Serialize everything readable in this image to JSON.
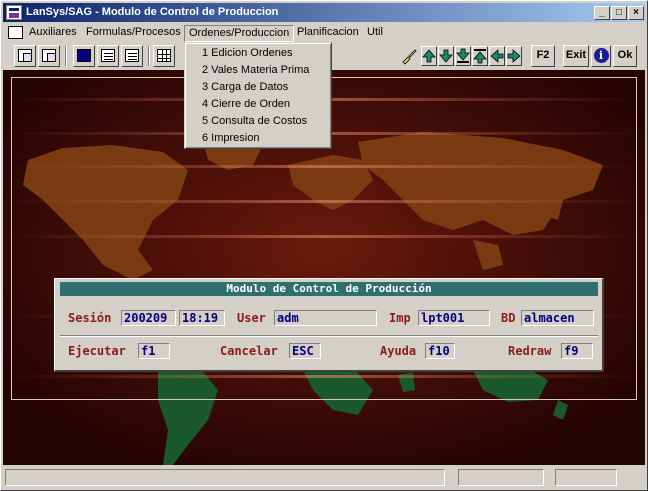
{
  "window": {
    "title": "LanSys/SAG - Modulo de Control de Produccion",
    "minimize": "_",
    "maximize": "□",
    "close": "×"
  },
  "menubar": {
    "items": [
      "Auxiliares",
      "Formulas/Procesos",
      "Ordenes/Produccion",
      "Planificacion",
      "Util"
    ],
    "active": "Ordenes/Produccion"
  },
  "dropdown": {
    "items": [
      "1 Edicion Ordenes",
      "2 Vales Materia Prima",
      "3 Carga de Datos",
      "4 Cierre de Orden",
      "5 Consulta de Costos",
      "6 Impresion"
    ]
  },
  "toolbar": {
    "f2": "F2",
    "exit": "Exit",
    "info": "i",
    "ok": "Ok",
    "icons": [
      "copy-icon",
      "paste-icon",
      "monitor-icon",
      "form-icon",
      "grid-icon",
      "table-icon",
      "brush-icon",
      "arrow-up-icon",
      "arrow-down-icon",
      "arrow-down-end-icon",
      "arrow-up-end-icon",
      "arrow-left-icon",
      "arrow-right-icon"
    ]
  },
  "dialog": {
    "title": "Modulo de Control de Producción",
    "session_label": "Sesión",
    "session_value": "200209",
    "time_value": "18:19",
    "user_label": "User",
    "user_value": "adm",
    "imp_label": "Imp",
    "imp_value": "lpt001",
    "bd_label": "BD",
    "bd_value": "almacen",
    "ejecutar_label": "Ejecutar",
    "ejecutar_key": "f1",
    "cancelar_label": "Cancelar",
    "cancelar_key": "ESC",
    "ayuda_label": "Ayuda",
    "ayuda_key": "f10",
    "redraw_label": "Redraw",
    "redraw_key": "f9"
  },
  "colors": {
    "titlebar_start": "#0a246a",
    "background_dark": "#3a0806",
    "continents": "#7a3a12",
    "south_continents": "#1a5a2a",
    "dialog_title": "#2f6f6f",
    "label_red": "#8b1a1a",
    "field_blue": "#000080"
  }
}
